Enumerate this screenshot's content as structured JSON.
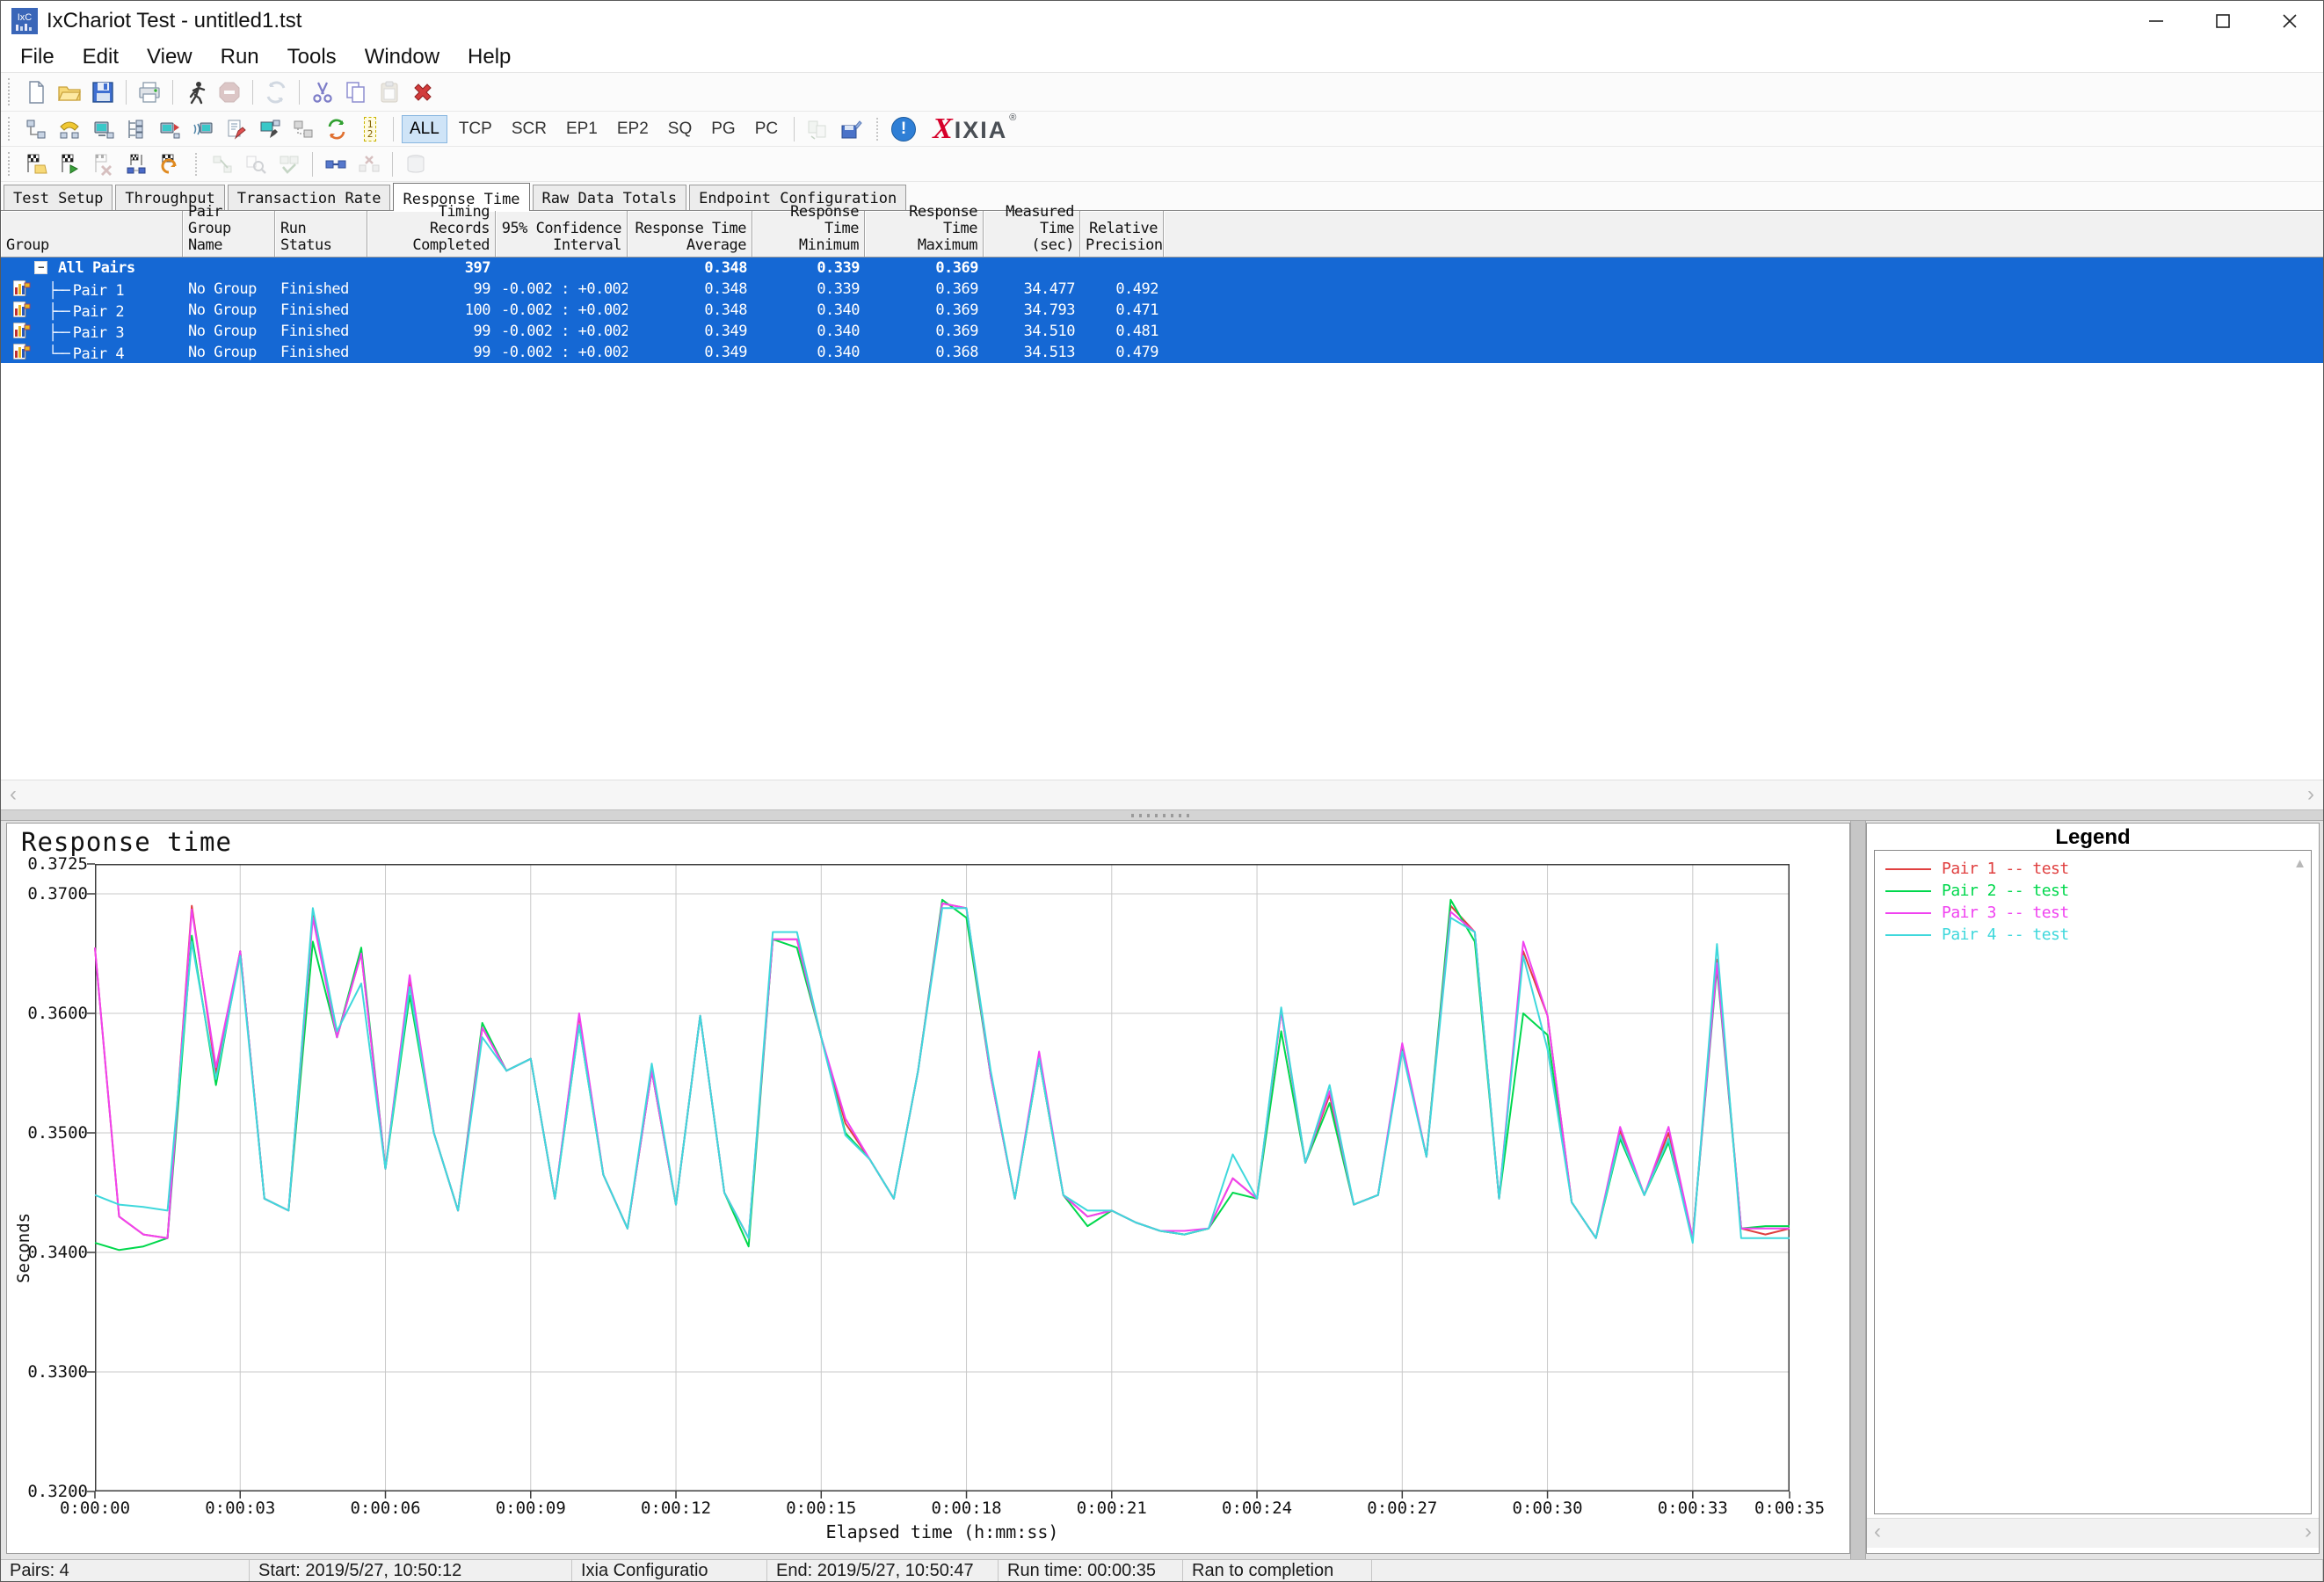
{
  "window": {
    "title": "IxChariot Test - untitled1.tst",
    "icon_text": "IxC"
  },
  "menu": {
    "items": [
      "File",
      "Edit",
      "View",
      "Run",
      "Tools",
      "Window",
      "Help"
    ]
  },
  "toolbar_modes": {
    "buttons": [
      "ALL",
      "TCP",
      "SCR",
      "EP1",
      "EP2",
      "SQ",
      "PG",
      "PC"
    ],
    "active": "ALL"
  },
  "brand": {
    "logo_mark": "X",
    "logo_name": "IXIA",
    "logo_reg": "®"
  },
  "icons": {
    "arrow_up": "▲",
    "arrow_left": "‹",
    "arrow_right": "›",
    "info_mark": "!",
    "collapse_glyph": "−",
    "renumber_label": "1\n2"
  },
  "tabs": {
    "items": [
      "Test Setup",
      "Throughput",
      "Transaction Rate",
      "Response Time",
      "Raw Data Totals",
      "Endpoint Configuration"
    ],
    "active": "Response Time"
  },
  "table": {
    "columns": [
      {
        "key": "group",
        "label": "Group"
      },
      {
        "key": "pair_group_name",
        "label": "Pair Group\nName"
      },
      {
        "key": "run_status",
        "label": "Run Status"
      },
      {
        "key": "timing_records_completed",
        "label": "Timing Records\nCompleted"
      },
      {
        "key": "confidence_interval",
        "label": "95% Confidence\nInterval"
      },
      {
        "key": "response_time_average",
        "label": "Response Time\nAverage"
      },
      {
        "key": "response_time_minimum",
        "label": "Response Time\nMinimum"
      },
      {
        "key": "response_time_maximum",
        "label": "Response Time\nMaximum"
      },
      {
        "key": "measured_time_sec",
        "label": "Measured\nTime (sec)"
      },
      {
        "key": "relative_precision",
        "label": "Relative\nPrecision"
      }
    ],
    "rows": [
      {
        "kind": "summary",
        "label": "All Pairs",
        "values": {
          "pair_group_name": "",
          "run_status": "",
          "timing_records_completed": "397",
          "confidence_interval": "",
          "response_time_average": "0.348",
          "response_time_minimum": "0.339",
          "response_time_maximum": "0.369",
          "measured_time_sec": "",
          "relative_precision": ""
        }
      },
      {
        "kind": "pair",
        "label": "Pair 1",
        "tree": "├──",
        "values": {
          "pair_group_name": "No Group",
          "run_status": "Finished",
          "timing_records_completed": "99",
          "confidence_interval": "-0.002 : +0.002",
          "response_time_average": "0.348",
          "response_time_minimum": "0.339",
          "response_time_maximum": "0.369",
          "measured_time_sec": "34.477",
          "relative_precision": "0.492"
        }
      },
      {
        "kind": "pair",
        "label": "Pair 2",
        "tree": "├──",
        "values": {
          "pair_group_name": "No Group",
          "run_status": "Finished",
          "timing_records_completed": "100",
          "confidence_interval": "-0.002 : +0.002",
          "response_time_average": "0.348",
          "response_time_minimum": "0.340",
          "response_time_maximum": "0.369",
          "measured_time_sec": "34.793",
          "relative_precision": "0.471"
        }
      },
      {
        "kind": "pair",
        "label": "Pair 3",
        "tree": "├──",
        "values": {
          "pair_group_name": "No Group",
          "run_status": "Finished",
          "timing_records_completed": "99",
          "confidence_interval": "-0.002 : +0.002",
          "response_time_average": "0.349",
          "response_time_minimum": "0.340",
          "response_time_maximum": "0.369",
          "measured_time_sec": "34.510",
          "relative_precision": "0.481"
        }
      },
      {
        "kind": "pair",
        "label": "Pair 4",
        "tree": "└──",
        "values": {
          "pair_group_name": "No Group",
          "run_status": "Finished",
          "timing_records_completed": "99",
          "confidence_interval": "-0.002 : +0.002",
          "response_time_average": "0.349",
          "response_time_minimum": "0.340",
          "response_time_maximum": "0.368",
          "measured_time_sec": "34.513",
          "relative_precision": "0.479"
        }
      }
    ]
  },
  "chart_data": {
    "type": "line",
    "title": "Response time",
    "xlabel": "Elapsed time (h:mm:ss)",
    "ylabel": "Seconds",
    "xlim_seconds": [
      0,
      35
    ],
    "ylim": [
      0.32,
      0.3725
    ],
    "sample_interval_seconds": 0.5,
    "grid": true,
    "legend_position": "right",
    "y_ticks": [
      {
        "v": 0.3725,
        "label": "0.3725"
      },
      {
        "v": 0.37,
        "label": "0.3700"
      },
      {
        "v": 0.36,
        "label": "0.3600"
      },
      {
        "v": 0.35,
        "label": "0.3500"
      },
      {
        "v": 0.34,
        "label": "0.3400"
      },
      {
        "v": 0.33,
        "label": "0.3300"
      },
      {
        "v": 0.32,
        "label": "0.3200"
      }
    ],
    "y_gridlines": [
      0.37,
      0.36,
      0.35,
      0.34,
      0.33
    ],
    "x_ticks": [
      {
        "t": 0,
        "label": "0:00:00"
      },
      {
        "t": 3,
        "label": "0:00:03"
      },
      {
        "t": 6,
        "label": "0:00:06"
      },
      {
        "t": 9,
        "label": "0:00:09"
      },
      {
        "t": 12,
        "label": "0:00:12"
      },
      {
        "t": 15,
        "label": "0:00:15"
      },
      {
        "t": 18,
        "label": "0:00:18"
      },
      {
        "t": 21,
        "label": "0:00:21"
      },
      {
        "t": 24,
        "label": "0:00:24"
      },
      {
        "t": 27,
        "label": "0:00:27"
      },
      {
        "t": 30,
        "label": "0:00:30"
      },
      {
        "t": 33,
        "label": "0:00:33"
      },
      {
        "t": 35,
        "label": "0:00:35"
      }
    ],
    "series": [
      {
        "name": "Pair 1 -- test",
        "color": "#e04040",
        "values": [
          0.3655,
          0.343,
          0.3415,
          0.3412,
          0.369,
          0.355,
          0.3652,
          0.3445,
          0.3435,
          0.3685,
          0.358,
          0.365,
          0.347,
          0.3628,
          0.35,
          0.3435,
          0.3588,
          0.3552,
          0.3562,
          0.3445,
          0.3598,
          0.3465,
          0.342,
          0.3552,
          0.344,
          0.3598,
          0.345,
          0.3412,
          0.3662,
          0.3662,
          0.358,
          0.3508,
          0.3478,
          0.3445,
          0.3552,
          0.3692,
          0.3688,
          0.3548,
          0.3445,
          0.3562,
          0.3448,
          0.343,
          0.3435,
          0.3425,
          0.3418,
          0.3415,
          0.342,
          0.3462,
          0.3445,
          0.3602,
          0.3475,
          0.3532,
          0.344,
          0.3448,
          0.3572,
          0.348,
          0.369,
          0.3668,
          0.3445,
          0.3652,
          0.3598,
          0.3442,
          0.3412,
          0.3502,
          0.3448,
          0.35,
          0.3412,
          0.3645,
          0.342,
          0.3415,
          0.342
        ]
      },
      {
        "name": "Pair 2 -- test",
        "color": "#00d84c",
        "values": [
          0.3408,
          0.3402,
          0.3405,
          0.3412,
          0.3665,
          0.354,
          0.3652,
          0.3445,
          0.3435,
          0.366,
          0.358,
          0.3655,
          0.347,
          0.3615,
          0.35,
          0.3435,
          0.3592,
          0.3552,
          0.3562,
          0.3445,
          0.359,
          0.3465,
          0.342,
          0.3552,
          0.344,
          0.3598,
          0.345,
          0.3405,
          0.3662,
          0.3655,
          0.358,
          0.35,
          0.3478,
          0.3445,
          0.3552,
          0.3695,
          0.368,
          0.3548,
          0.3445,
          0.3562,
          0.3448,
          0.3422,
          0.3435,
          0.3425,
          0.3418,
          0.3415,
          0.342,
          0.345,
          0.3445,
          0.3585,
          0.3475,
          0.3525,
          0.344,
          0.3448,
          0.3572,
          0.348,
          0.3695,
          0.366,
          0.3445,
          0.36,
          0.3582,
          0.3442,
          0.3412,
          0.3495,
          0.3448,
          0.3492,
          0.3412,
          0.3638,
          0.342,
          0.3422,
          0.3422
        ]
      },
      {
        "name": "Pair 3 -- test",
        "color": "#f042f0",
        "values": [
          0.3655,
          0.343,
          0.3415,
          0.3412,
          0.3687,
          0.3555,
          0.3652,
          0.3445,
          0.3435,
          0.368,
          0.358,
          0.365,
          0.347,
          0.3632,
          0.35,
          0.3435,
          0.3588,
          0.3552,
          0.3562,
          0.3445,
          0.36,
          0.3465,
          0.342,
          0.3552,
          0.344,
          0.3598,
          0.345,
          0.3412,
          0.3662,
          0.3662,
          0.358,
          0.3512,
          0.3478,
          0.3445,
          0.3552,
          0.3692,
          0.3688,
          0.3548,
          0.3445,
          0.3568,
          0.3448,
          0.343,
          0.3435,
          0.3425,
          0.3418,
          0.3418,
          0.342,
          0.3462,
          0.3445,
          0.3602,
          0.3475,
          0.3535,
          0.344,
          0.3448,
          0.3575,
          0.348,
          0.3685,
          0.3668,
          0.3445,
          0.366,
          0.3598,
          0.3442,
          0.3412,
          0.3505,
          0.3448,
          0.3505,
          0.3412,
          0.3642,
          0.342,
          0.342,
          0.342
        ]
      },
      {
        "name": "Pair 4 -- test",
        "color": "#3fd8dc",
        "values": [
          0.3448,
          0.344,
          0.3438,
          0.3435,
          0.366,
          0.3545,
          0.3648,
          0.3445,
          0.3435,
          0.3688,
          0.3585,
          0.3625,
          0.347,
          0.3622,
          0.35,
          0.3435,
          0.358,
          0.3552,
          0.3562,
          0.3445,
          0.359,
          0.3465,
          0.342,
          0.3558,
          0.344,
          0.3598,
          0.345,
          0.3412,
          0.3668,
          0.3668,
          0.358,
          0.3498,
          0.3478,
          0.3445,
          0.3552,
          0.3688,
          0.3688,
          0.3552,
          0.3445,
          0.3562,
          0.3448,
          0.3435,
          0.3435,
          0.3425,
          0.3418,
          0.3415,
          0.342,
          0.3482,
          0.3445,
          0.3605,
          0.3475,
          0.354,
          0.344,
          0.3448,
          0.3568,
          0.348,
          0.368,
          0.3668,
          0.3445,
          0.3648,
          0.357,
          0.3442,
          0.3412,
          0.3498,
          0.3448,
          0.3495,
          0.3408,
          0.3658,
          0.3412,
          0.3412,
          0.3412
        ]
      }
    ]
  },
  "legend": {
    "title": "Legend"
  },
  "status_bar": {
    "segments": [
      "Pairs: 4",
      "Start: 2019/5/27, 10:50:12",
      "Ixia Configuratio",
      "End: 2019/5/27, 10:50:47",
      "Run time: 00:00:35",
      "Ran to completion",
      ""
    ]
  },
  "colors": {
    "selection_blue": "#1568d4",
    "mode_active_bg": "#cfe4f7",
    "logo_red": "#d6002a",
    "grid_line": "#c9c9c9",
    "axis": "#3c3c3c",
    "series": [
      "#e04040",
      "#00d84c",
      "#f042f0",
      "#3fd8dc"
    ]
  }
}
